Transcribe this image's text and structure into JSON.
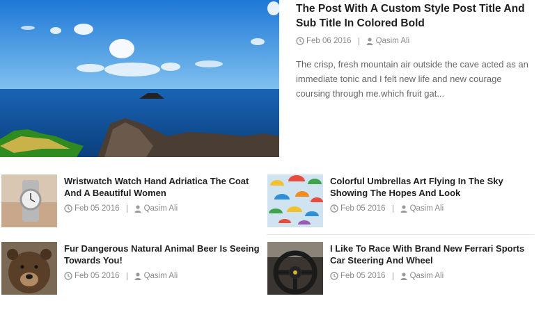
{
  "featured": {
    "image_alt": "ocean-rocks-photo",
    "title": "The Post With A Custom Style Post Title And Sub Title In Colored Bold",
    "date": "Feb 06 2016",
    "author": "Qasim Ali",
    "excerpt": "The crisp, fresh mountain air outside the cave acted as an immediate tonic and I felt new life and new courage coursing through me.which fruit gat..."
  },
  "posts": [
    {
      "title": "Wristwatch Watch Hand Adriatica The Coat And A Beautiful Women",
      "date": "Feb 05 2016",
      "author": "Qasim Ali",
      "thumb": "wristwatch-photo"
    },
    {
      "title": "Colorful Umbrellas Art Flying In The Sky Showing The Hopes And Look",
      "date": "Feb 05 2016",
      "author": "Qasim Ali",
      "thumb": "umbrellas-photo"
    },
    {
      "title": "Fur Dangerous Natural Animal Beer Is Seeing Towards You!",
      "date": "Feb 05 2016",
      "author": "Qasim Ali",
      "thumb": "bear-photo"
    },
    {
      "title": "I Like To Race With Brand New Ferrari Sports Car Steering And Wheel",
      "date": "Feb 05 2016",
      "author": "Qasim Ali",
      "thumb": "steering-wheel-photo"
    }
  ],
  "icons": {
    "date": "clock-icon",
    "author": "user-icon"
  }
}
